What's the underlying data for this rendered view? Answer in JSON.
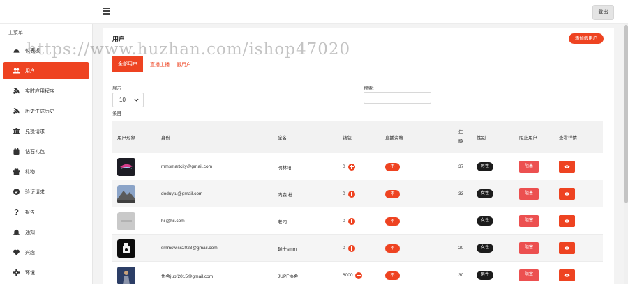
{
  "header": {
    "logout_label": "登出"
  },
  "sidebar": {
    "heading": "主菜单",
    "items": [
      {
        "label": "仪表板",
        "icon": "dashboard-icon",
        "active": false
      },
      {
        "label": "用户",
        "icon": "users-icon",
        "active": true
      },
      {
        "label": "实时应用程序",
        "icon": "rss-icon",
        "active": false
      },
      {
        "label": "历史生成历史",
        "icon": "rss-icon",
        "active": false
      },
      {
        "label": "兑换请求",
        "icon": "bank-icon",
        "active": false
      },
      {
        "label": "钻石礼包",
        "icon": "calendar-icon",
        "active": false
      },
      {
        "label": "礼物",
        "icon": "gift-icon",
        "active": false
      },
      {
        "label": "验证请求",
        "icon": "check-circle-icon",
        "active": false
      },
      {
        "label": "报告",
        "icon": "question-icon",
        "active": false
      },
      {
        "label": "通知",
        "icon": "bell-icon",
        "active": false
      },
      {
        "label": "兴趣",
        "icon": "heart-icon",
        "active": false
      },
      {
        "label": "环境",
        "icon": "settings-icon",
        "active": false
      }
    ]
  },
  "main": {
    "title": "用户",
    "add_user_label": "添加假用户",
    "tabs": [
      {
        "label": "全部用户",
        "active": true
      },
      {
        "label": "直播主播",
        "active": false
      },
      {
        "label": "假用户",
        "active": false
      }
    ],
    "show_label": "展示",
    "show_value": "10",
    "entries_label": "条目",
    "search_label": "搜索:",
    "search_value": "",
    "columns": {
      "avatar": "用户形象",
      "identity": "身份",
      "fullname": "全名",
      "wallet": "钱包",
      "live": "直播资格",
      "age_1": "年",
      "age_2": "龄",
      "gender": "性别",
      "block": "阻止用户",
      "details": "查看详情"
    },
    "rows": [
      {
        "identity": "mmsmartcity@gmail.com",
        "fullname": "明林阳",
        "wallet": "0",
        "live": "不",
        "age": "37",
        "gender": "男性",
        "block": "阻塞"
      },
      {
        "identity": "doduytu@gmail.com",
        "fullname": "内森 杜",
        "wallet": "0",
        "live": "不",
        "age": "33",
        "gender": "女性",
        "block": "阻塞"
      },
      {
        "identity": "hii@hii.com",
        "fullname": "老同",
        "wallet": "0",
        "live": "不",
        "age": "",
        "gender": "女性",
        "block": "阻塞"
      },
      {
        "identity": "smmswiss2023@gmail.com",
        "fullname": "瑞士smm",
        "wallet": "0",
        "live": "不",
        "age": "20",
        "gender": "女性",
        "block": "阻塞"
      },
      {
        "identity": "协会jupf2015@gmail.com",
        "fullname": "JUPF协会",
        "wallet": "6000",
        "live": "不",
        "age": "30",
        "gender": "男性",
        "block": "阻塞"
      }
    ]
  },
  "watermark": "https://www.huzhan.com/ishop47020",
  "colors": {
    "accent": "#ee4321",
    "block": "#ec5050",
    "badge": "#1c1c1c"
  }
}
